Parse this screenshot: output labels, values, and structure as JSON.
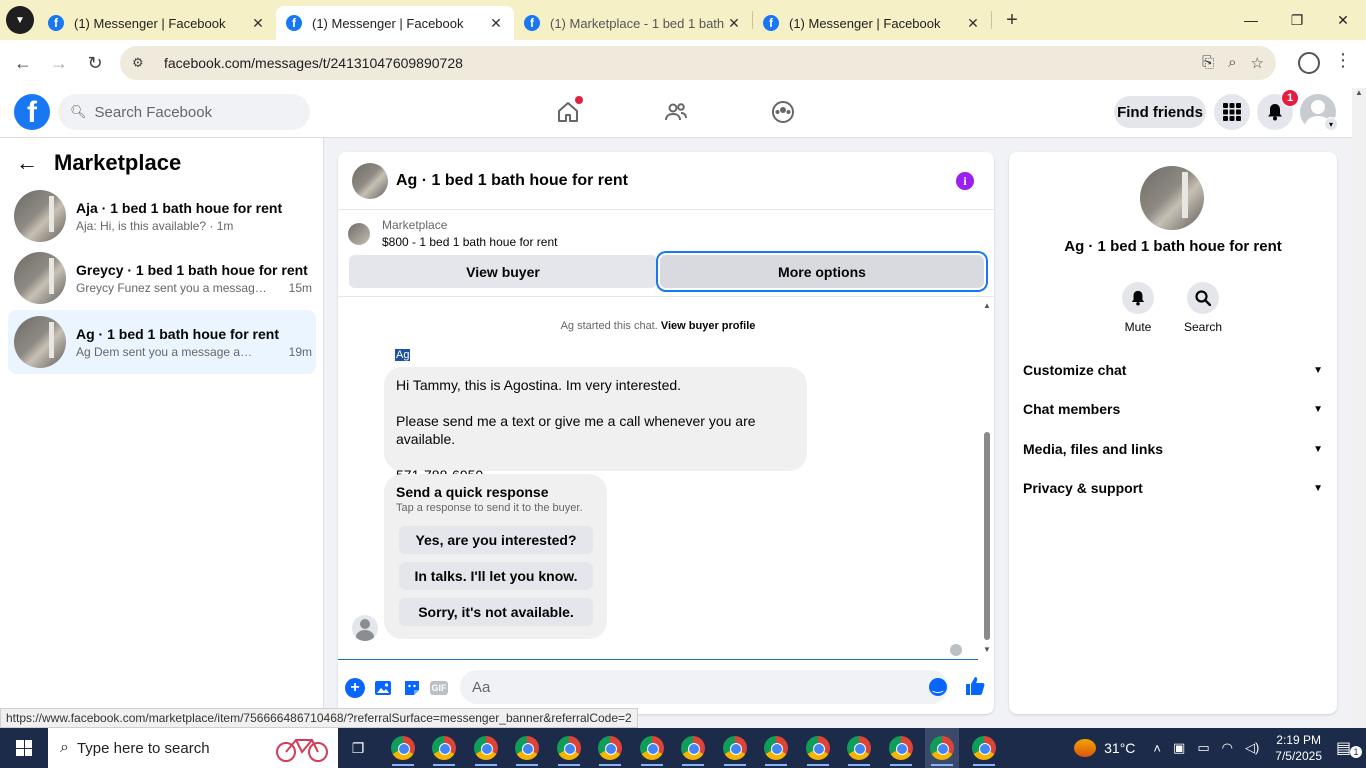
{
  "browser": {
    "tabs": [
      {
        "title": "(1) Messenger | Facebook",
        "active": false
      },
      {
        "title": "(1) Messenger | Facebook",
        "active": true
      },
      {
        "title": "(1) Marketplace - 1 bed 1 bath h",
        "active": false
      },
      {
        "title": "(1) Messenger | Facebook",
        "active": false
      }
    ],
    "url": "facebook.com/messages/t/24131047609890728"
  },
  "fb_header": {
    "search_placeholder": "Search Facebook",
    "find_friends": "Find friends",
    "notification_count": "1"
  },
  "sidebar": {
    "title": "Marketplace",
    "conversations": [
      {
        "title": "Aja · 1 bed 1 bath houe for rent",
        "snippet": "Aja: Hi, is this available? · 1m",
        "time": ""
      },
      {
        "title": "Greycy · 1 bed 1 bath houe for rent",
        "snippet": "Greycy Funez sent you a message a...",
        "time": "15m"
      },
      {
        "title": "Ag · 1 bed 1 bath houe for rent",
        "snippet": "Ag Dem sent you a message about ...",
        "time": "19m"
      }
    ]
  },
  "chat": {
    "title": "Ag · 1 bed 1 bath houe for rent",
    "listing_source": "Marketplace",
    "listing_price": "$800 - 1 bed 1 bath houe for rent",
    "view_buyer": "View buyer",
    "more_options": "More options",
    "started_text": "Ag started this chat.",
    "view_buyer_profile": "View buyer profile",
    "sender": "Ag",
    "message_lines": [
      "Hi Tammy, this is Agostina. Im very interested.",
      "Please send me a text or give me a call whenever you are available.",
      "571-788-6950"
    ],
    "quick_response": {
      "heading": "Send a quick response",
      "subtext": "Tap a response to send it to the buyer.",
      "options": [
        "Yes, are you interested?",
        "In talks. I'll let you know.",
        "Sorry, it's not available."
      ]
    },
    "composer_placeholder": "Aa",
    "composer_icons": [
      "plus-icon",
      "photo-icon",
      "sticker-icon",
      "gif-icon"
    ],
    "gif_label": "GIF"
  },
  "info_panel": {
    "name": "Ag · 1 bed 1 bath houe for rent",
    "actions": [
      {
        "label": "Mute",
        "icon": "bell-icon"
      },
      {
        "label": "Search",
        "icon": "search-icon"
      }
    ],
    "sections": [
      "Customize chat",
      "Chat members",
      "Media, files and links",
      "Privacy & support"
    ]
  },
  "status_link": "https://www.facebook.com/marketplace/item/756666486710468/?referralSurface=messenger_banner&referralCode=2",
  "taskbar": {
    "search_placeholder": "Type here to search",
    "weather": "31°C",
    "time": "2:19 PM",
    "date": "7/5/2025",
    "notification_count": "1"
  }
}
